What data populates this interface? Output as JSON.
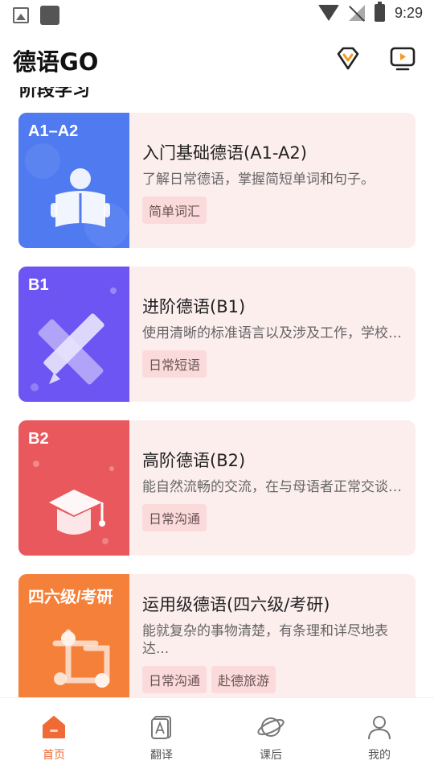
{
  "status": {
    "time": "9:29"
  },
  "header": {
    "title": "德语GO"
  },
  "section": {
    "title": "阶段学习"
  },
  "cards": [
    {
      "tag": "A1–A2",
      "title": "入门基础德语(A1-A2)",
      "desc": "了解日常德语，掌握简短单词和句子。",
      "chips": [
        "简单词汇"
      ]
    },
    {
      "tag": "B1",
      "title": "进阶德语(B1)",
      "desc": "使用清晰的标准语言以及涉及工作，学校…",
      "chips": [
        "日常短语"
      ]
    },
    {
      "tag": "B2",
      "title": "高阶德语(B2)",
      "desc": "能自然流畅的交流，在与母语者正常交谈…",
      "chips": [
        "日常沟通"
      ]
    },
    {
      "tag": "四六级/考研",
      "title": "运用级德语(四六级/考研)",
      "desc": "能就复杂的事物清楚，有条理和详尽地表达...",
      "chips": [
        "日常沟通",
        "赴德旅游"
      ]
    }
  ],
  "nav": [
    {
      "label": "首页"
    },
    {
      "label": "翻译"
    },
    {
      "label": "课后"
    },
    {
      "label": "我的"
    }
  ],
  "colors": {
    "accent": "#f06a35",
    "card_bg": "#fdeeee",
    "a1": "#4f7af0",
    "b1": "#6c55f2",
    "b2": "#e8585c",
    "exam": "#f5803a"
  }
}
